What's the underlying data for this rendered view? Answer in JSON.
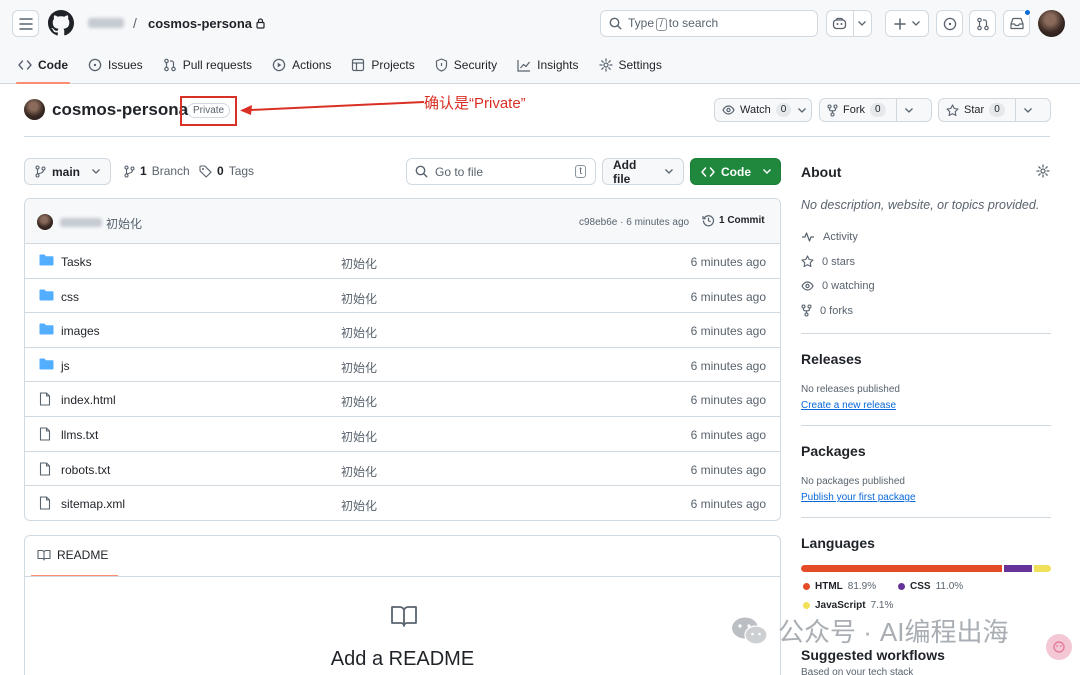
{
  "header": {
    "repo_name": "cosmos-persona",
    "separator": "/",
    "search_before": "Type",
    "search_key": "/",
    "search_after": "to search"
  },
  "tabs": [
    {
      "label": "Code",
      "icon": "code-icon"
    },
    {
      "label": "Issues",
      "icon": "issue-icon"
    },
    {
      "label": "Pull requests",
      "icon": "pull-request-icon"
    },
    {
      "label": "Actions",
      "icon": "play-icon"
    },
    {
      "label": "Projects",
      "icon": "table-icon"
    },
    {
      "label": "Security",
      "icon": "shield-icon"
    },
    {
      "label": "Insights",
      "icon": "graph-icon"
    },
    {
      "label": "Settings",
      "icon": "gear-icon"
    }
  ],
  "repo": {
    "title": "cosmos-persona",
    "visibility": "Private",
    "annotation": "确认是“Private”",
    "watch_label": "Watch",
    "watch_count": "0",
    "fork_label": "Fork",
    "fork_count": "0",
    "star_label": "Star",
    "star_count": "0"
  },
  "toolbar": {
    "branch": "main",
    "branch_count": "1",
    "branch_label": "Branch",
    "tags_count": "0",
    "tags_label": "Tags",
    "gofile_placeholder": "Go to file",
    "gofile_key": "t",
    "add_file": "Add file",
    "code_button": "Code"
  },
  "commit": {
    "message": "初始化",
    "hash_time": "c98eb6e · 6 minutes ago",
    "commit_count": "1 Commit"
  },
  "files": [
    {
      "name": "Tasks",
      "type": "folder",
      "message": "初始化",
      "time": "6 minutes ago"
    },
    {
      "name": "css",
      "type": "folder",
      "message": "初始化",
      "time": "6 minutes ago"
    },
    {
      "name": "images",
      "type": "folder",
      "message": "初始化",
      "time": "6 minutes ago"
    },
    {
      "name": "js",
      "type": "folder",
      "message": "初始化",
      "time": "6 minutes ago"
    },
    {
      "name": "index.html",
      "type": "file",
      "message": "初始化",
      "time": "6 minutes ago"
    },
    {
      "name": "llms.txt",
      "type": "file",
      "message": "初始化",
      "time": "6 minutes ago"
    },
    {
      "name": "robots.txt",
      "type": "file",
      "message": "初始化",
      "time": "6 minutes ago"
    },
    {
      "name": "sitemap.xml",
      "type": "file",
      "message": "初始化",
      "time": "6 minutes ago"
    }
  ],
  "readme": {
    "tab_label": "README",
    "title": "Add a README"
  },
  "about": {
    "heading": "About",
    "description": "No description, website, or topics provided.",
    "activity": "Activity",
    "stars": "0 stars",
    "watching": "0 watching",
    "forks": "0 forks"
  },
  "releases": {
    "heading": "Releases",
    "none": "No releases published",
    "link": "Create a new release"
  },
  "packages": {
    "heading": "Packages",
    "none": "No packages published",
    "link": "Publish your first package"
  },
  "languages": {
    "heading": "Languages",
    "items": [
      {
        "name": "HTML",
        "percent": "81.9%",
        "value": 81.9,
        "color": "#e34c26"
      },
      {
        "name": "CSS",
        "percent": "11.0%",
        "value": 11.0,
        "color": "#663399"
      },
      {
        "name": "JavaScript",
        "percent": "7.1%",
        "value": 7.1,
        "color": "#f1e05a"
      }
    ]
  },
  "workflows": {
    "heading": "Suggested workflows",
    "sub": "Based on your tech stack"
  },
  "watermark": "AI编程出海",
  "watermark_prefix": "公众号 ·"
}
